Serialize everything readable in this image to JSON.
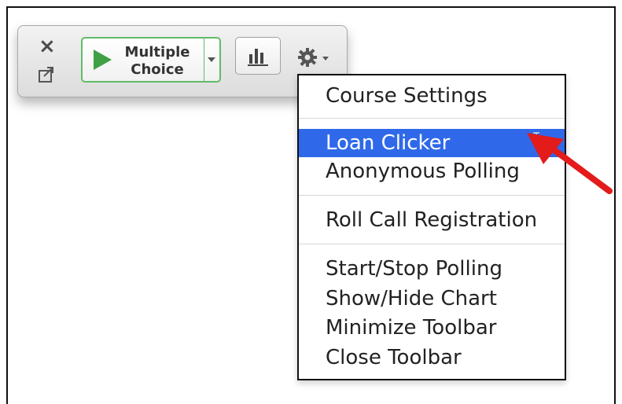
{
  "toolbar": {
    "close_symbol": "×",
    "poll_mode": {
      "label_line1": "Multiple",
      "label_line2": "Choice"
    },
    "icons": {
      "close": "close-icon",
      "popout": "popout-icon",
      "play": "play-icon",
      "chart": "bar-chart-icon",
      "settings": "gear-icon",
      "dropdown": "chevron-down-icon"
    }
  },
  "menu": {
    "items": [
      {
        "label": "Course Settings"
      },
      {
        "label": "Loan Clicker",
        "highlighted": true
      },
      {
        "label": "Anonymous Polling"
      },
      {
        "label": "Roll Call Registration"
      },
      {
        "label": "Start/Stop Polling"
      },
      {
        "label": "Show/Hide Chart"
      },
      {
        "label": "Minimize Toolbar"
      },
      {
        "label": "Close Toolbar"
      }
    ]
  },
  "colors": {
    "accent_green": "#3fa143",
    "menu_highlight": "#2f69ea",
    "callout_arrow": "#e31b1b"
  }
}
